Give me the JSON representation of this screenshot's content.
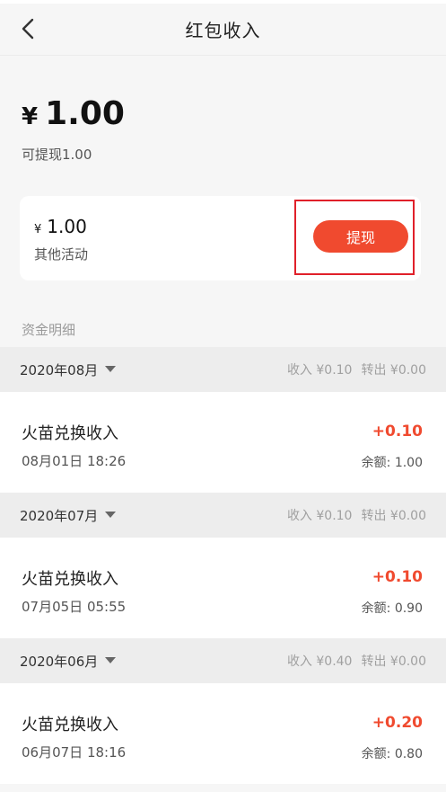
{
  "header": {
    "title": "红包收入",
    "back_icon": "chevron-left-icon"
  },
  "balance": {
    "currency": "¥",
    "amount": "1.00",
    "withdrawable": "可提现1.00"
  },
  "card": {
    "currency": "¥",
    "amount": "1.00",
    "label": "其他活动",
    "withdraw_label": "提现",
    "accent_color": "#f04a2f"
  },
  "section_label": "资金明细",
  "groups": [
    {
      "month": "2020年08月",
      "income": "收入 ¥0.10",
      "outgo": "转出 ¥0.00",
      "transaction": {
        "title": "火苗兑换收入",
        "time": "08月01日 18:26",
        "amount": "+0.10",
        "balance": "余额: 1.00"
      }
    },
    {
      "month": "2020年07月",
      "income": "收入 ¥0.10",
      "outgo": "转出 ¥0.00",
      "transaction": {
        "title": "火苗兑换收入",
        "time": "07月05日 05:55",
        "amount": "+0.10",
        "balance": "余额: 0.90"
      }
    },
    {
      "month": "2020年06月",
      "income": "收入 ¥0.40",
      "outgo": "转出 ¥0.00",
      "transaction": {
        "title": "火苗兑换收入",
        "time": "06月07日 18:16",
        "amount": "+0.20",
        "balance": "余额: 0.80"
      }
    }
  ]
}
